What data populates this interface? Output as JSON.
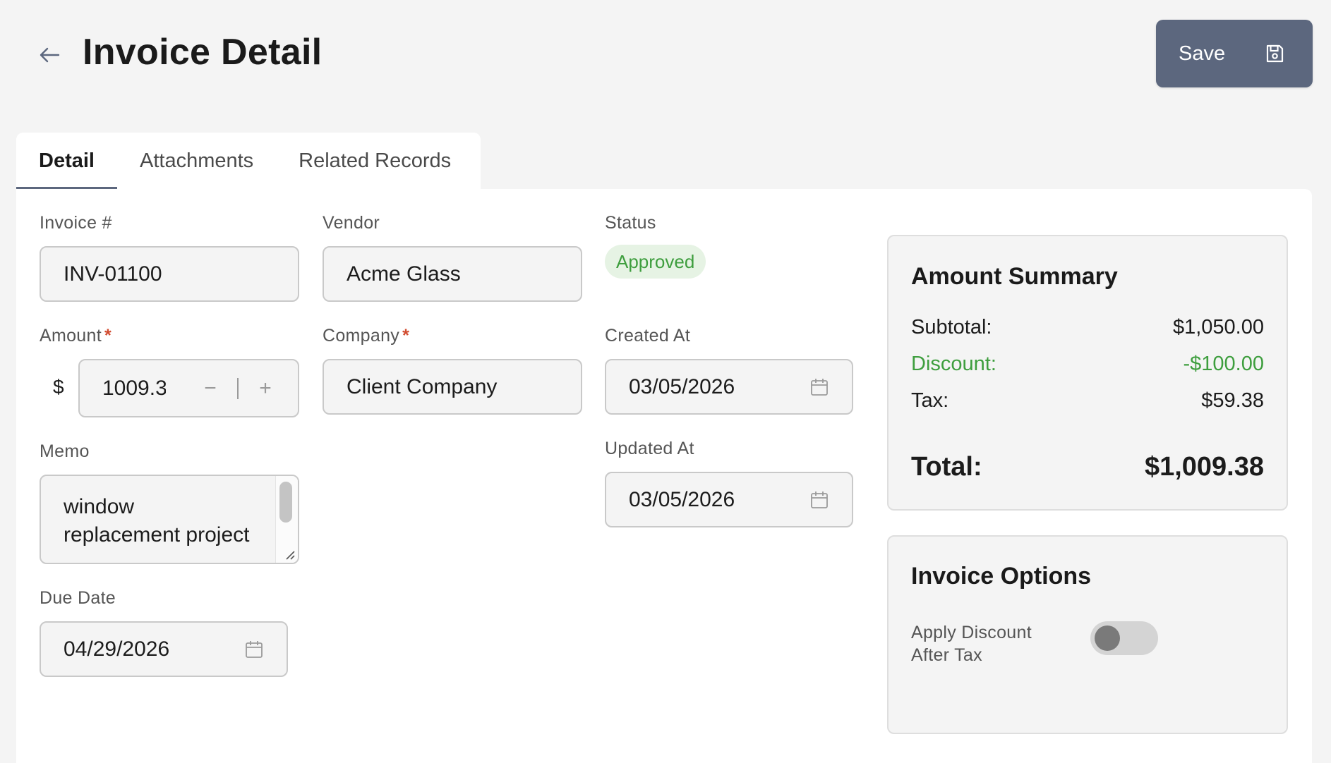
{
  "header": {
    "title": "Invoice Detail",
    "save_label": "Save"
  },
  "tabs": [
    {
      "label": "Detail",
      "active": true
    },
    {
      "label": "Attachments",
      "active": false
    },
    {
      "label": "Related Records",
      "active": false
    }
  ],
  "form": {
    "invoice_number": {
      "label": "Invoice #",
      "value": "INV-01100"
    },
    "vendor": {
      "label": "Vendor",
      "value": "Acme Glass"
    },
    "status": {
      "label": "Status",
      "value": "Approved"
    },
    "amount": {
      "label": "Amount",
      "required_mark": "*",
      "currency": "$",
      "value": "1009.38",
      "display": "1009.3",
      "minus": "−",
      "plus": "+"
    },
    "company": {
      "label": "Company",
      "required_mark": "*",
      "value": "Client Company"
    },
    "created_at": {
      "label": "Created At",
      "value": "03/05/2026"
    },
    "memo": {
      "label": "Memo",
      "value": "window replacement project"
    },
    "updated_at": {
      "label": "Updated At",
      "value": "03/05/2026"
    },
    "due_date": {
      "label": "Due Date",
      "value": "04/29/2026"
    }
  },
  "amount_summary": {
    "title": "Amount Summary",
    "subtotal_label": "Subtotal:",
    "subtotal": "$1,050.00",
    "discount_label": "Discount:",
    "discount": "-$100.00",
    "tax_label": "Tax:",
    "tax": "$59.38",
    "total_label": "Total:",
    "total": "$1,009.38"
  },
  "invoice_options": {
    "title": "Invoice Options",
    "apply_discount_after_tax_label": "Apply Discount After Tax",
    "apply_discount_after_tax": false
  },
  "colors": {
    "accent": "#5c677e",
    "status_green": "#3e9e3e",
    "required_red": "#d14b2f"
  }
}
